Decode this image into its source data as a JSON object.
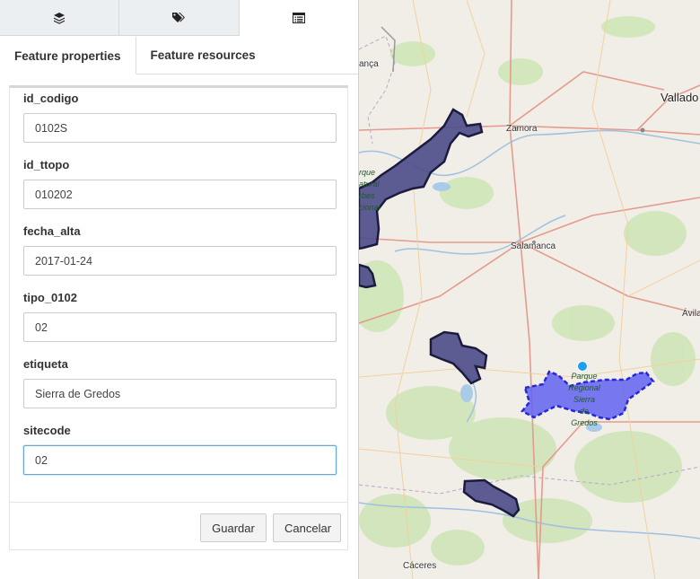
{
  "top_tabs": [
    {
      "icon": "layers-icon",
      "active": false
    },
    {
      "icon": "tags-icon",
      "active": false
    },
    {
      "icon": "list-alt-icon",
      "active": true
    }
  ],
  "sub_tabs": [
    {
      "label": "Feature properties",
      "active": true
    },
    {
      "label": "Feature resources",
      "active": false
    }
  ],
  "form": {
    "fields": [
      {
        "label": "id_codigo",
        "value": "0102S"
      },
      {
        "label": "id_ttopo",
        "value": "010202"
      },
      {
        "label": "fecha_alta",
        "value": "2017-01-24"
      },
      {
        "label": "tipo_0102",
        "value": "02"
      },
      {
        "label": "etiqueta",
        "value": "Sierra de Gredos"
      },
      {
        "label": "sitecode",
        "value": "02"
      }
    ]
  },
  "buttons": {
    "save": "Guardar",
    "cancel": "Cancelar"
  },
  "map": {
    "cities": {
      "zamora": "Zamora",
      "valladolid": "Vallado",
      "salamanca": "Salamanca",
      "avila": "Ávila",
      "caceres": "Cáceres",
      "left_fragment": "ança"
    },
    "park_labels": {
      "gredos": [
        "Parque",
        "Regional",
        "Sierra",
        "de Gredos"
      ],
      "left": [
        "rque",
        "atural",
        "rbes",
        "cional"
      ]
    },
    "colors": {
      "polygon_fill": "#4b4b8a",
      "polygon_stroke": "#1b1b3d",
      "selected_fill": "#6262f0",
      "selected_stroke": "#2727d8",
      "point": "#1aa0ee"
    }
  }
}
